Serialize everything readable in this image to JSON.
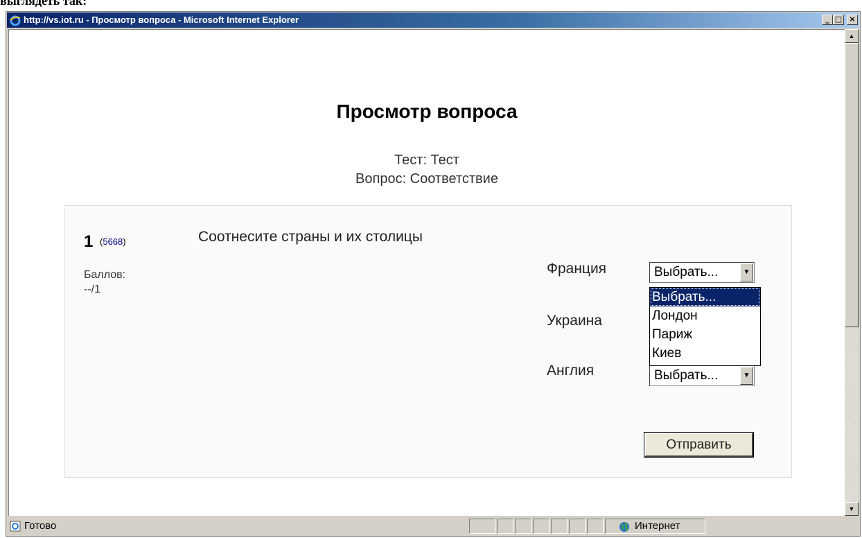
{
  "window": {
    "title": "http://vs.iot.ru - Просмотр вопроса - Microsoft Internet Explorer",
    "min": "_",
    "max": "□",
    "close": "×"
  },
  "page": {
    "title": "Просмотр вопроса",
    "test_line": "Тест: Тест",
    "question_line": "Вопрос: Соответствие"
  },
  "question": {
    "number": "1",
    "id_link": "5668",
    "score_label": "Баллов:",
    "score_value": "--/1",
    "text": "Соотнесите страны и их столицы",
    "rows": [
      {
        "country": "Франция",
        "selected": "Выбрать..."
      },
      {
        "country": "Украина",
        "selected": "Выбрать..."
      },
      {
        "country": "Англия",
        "selected": "Выбрать..."
      }
    ],
    "dropdown_options": [
      "Выбрать...",
      "Лондон",
      "Париж",
      "Киев"
    ],
    "submit_label": "Отправить"
  },
  "statusbar": {
    "status": "Готово",
    "zone": "Интернет"
  },
  "colors": {
    "titlebar_start": "#0a246a",
    "titlebar_end": "#a6caf0",
    "selection": "#0a246a",
    "link": "#00008b"
  }
}
